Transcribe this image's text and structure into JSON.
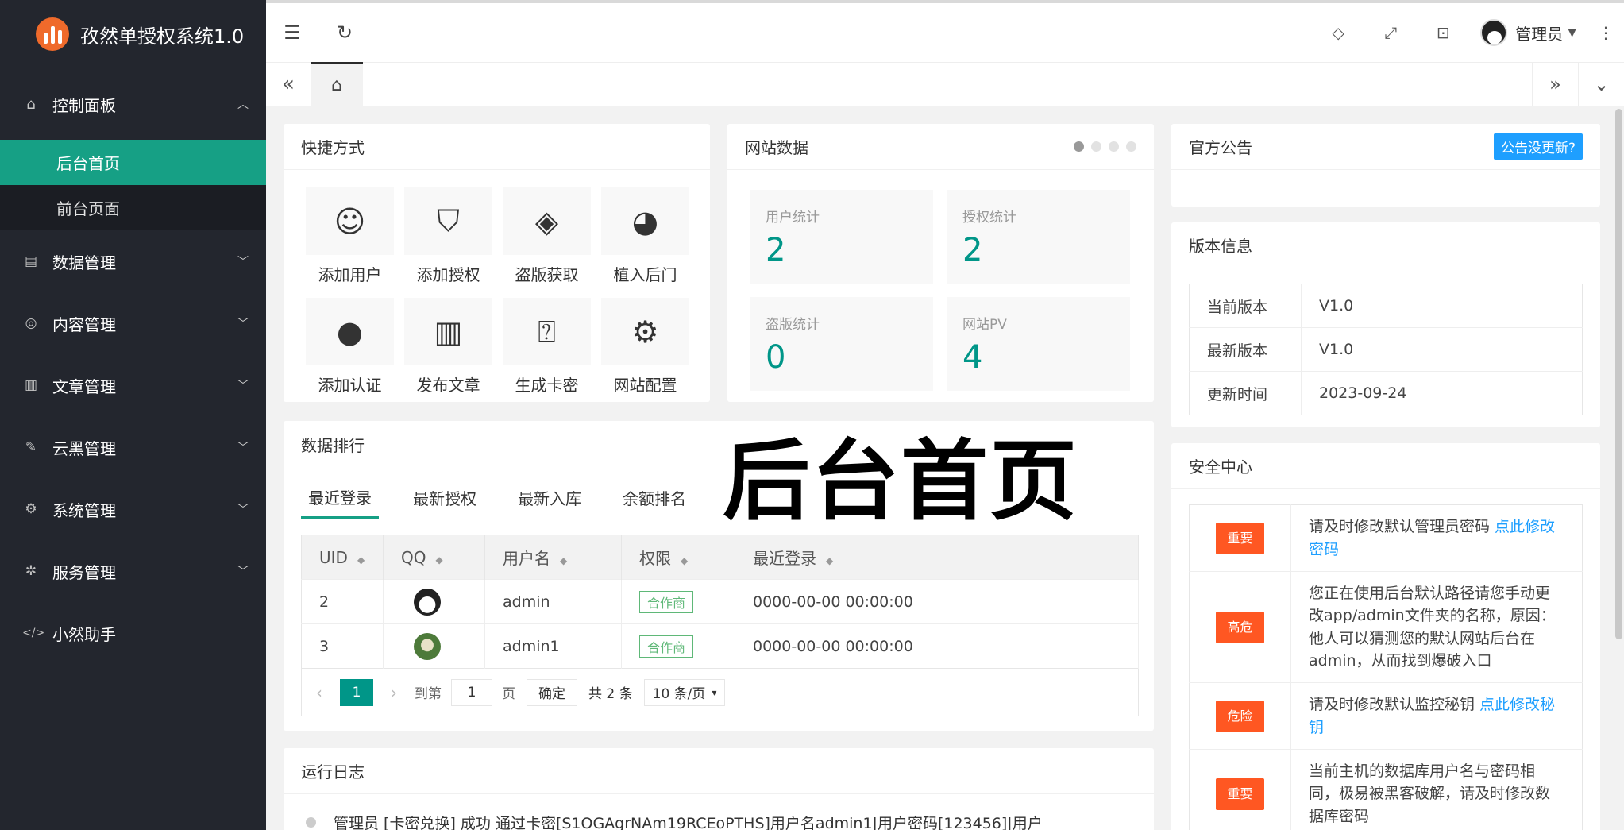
{
  "app": {
    "title": "孜然单授权系统1.0"
  },
  "sidebar": {
    "dashboard": {
      "label": "控制面板",
      "sub": [
        {
          "label": "后台首页",
          "active": true
        },
        {
          "label": "前台页面",
          "active": false
        }
      ]
    },
    "items": [
      {
        "label": "数据管理",
        "icon": "file-icon"
      },
      {
        "label": "内容管理",
        "icon": "globe-icon"
      },
      {
        "label": "文章管理",
        "icon": "book-icon"
      },
      {
        "label": "云黑管理",
        "icon": "broom-icon"
      },
      {
        "label": "系统管理",
        "icon": "gear-icon"
      },
      {
        "label": "服务管理",
        "icon": "service-icon"
      },
      {
        "label": "小然助手",
        "icon": "code-icon"
      }
    ]
  },
  "header": {
    "user": "管理员"
  },
  "overlay": {
    "title": "后台首页"
  },
  "quick": {
    "title": "快捷方式",
    "items": [
      {
        "label": "添加用户"
      },
      {
        "label": "添加授权"
      },
      {
        "label": "盗版获取"
      },
      {
        "label": "植入后门"
      },
      {
        "label": "添加认证"
      },
      {
        "label": "发布文章"
      },
      {
        "label": "生成卡密"
      },
      {
        "label": "网站配置"
      }
    ]
  },
  "site": {
    "title": "网站数据",
    "stats": [
      {
        "label": "用户统计",
        "value": "2"
      },
      {
        "label": "授权统计",
        "value": "2"
      },
      {
        "label": "盗版统计",
        "value": "0"
      },
      {
        "label": "网站PV",
        "value": "4"
      }
    ]
  },
  "ranking": {
    "title": "数据排行",
    "tabs": [
      "最近登录",
      "最新授权",
      "最新入库",
      "余额排名"
    ],
    "columns": [
      "UID",
      "QQ",
      "用户名",
      "权限",
      "最近登录"
    ],
    "rows": [
      {
        "uid": "2",
        "username": "admin",
        "role": "合作商",
        "last": "0000-00-00 00:00:00"
      },
      {
        "uid": "3",
        "username": "admin1",
        "role": "合作商",
        "last": "0000-00-00 00:00:00"
      }
    ],
    "pager": {
      "current": "1",
      "goto_label": "到第",
      "page_value": "1",
      "page_label": "页",
      "confirm": "确定",
      "total": "共 2 条",
      "per_page": "10 条/页"
    }
  },
  "log": {
    "title": "运行日志",
    "lines": [
      "管理员 [卡密兑换] 成功 通过卡密[S1OGAgrNAm19RCEoPTHS]用户名admin1|用户密码[123456]|用户"
    ]
  },
  "notice": {
    "title": "官方公告",
    "badge": "公告没更新?"
  },
  "version": {
    "title": "版本信息",
    "rows": [
      {
        "k": "当前版本",
        "v": "V1.0"
      },
      {
        "k": "最新版本",
        "v": "V1.0"
      },
      {
        "k": "更新时间",
        "v": "2023-09-24"
      }
    ]
  },
  "security": {
    "title": "安全中心",
    "rows": [
      {
        "level": "重要",
        "text": "请及时修改默认管理员密码 ",
        "link": "点此修改密码"
      },
      {
        "level": "高危",
        "text": "您正在使用后台默认路径请您手动更改app/admin文件夹的名称，原因：他人可以猜测您的默认网站后台在admin，从而找到爆破入口",
        "link": ""
      },
      {
        "level": "危险",
        "text": "请及时修改默认监控秘钥 ",
        "link": "点此修改秘钥"
      },
      {
        "level": "重要",
        "text": "当前主机的数据库用户名与密码相同，极易被黑客破解，请及时修改数据库密码",
        "link": ""
      }
    ]
  },
  "colors": {
    "accent": "#16a085",
    "sidebar": "#23262e",
    "danger": "#ff5722",
    "link": "#1e9fff"
  }
}
